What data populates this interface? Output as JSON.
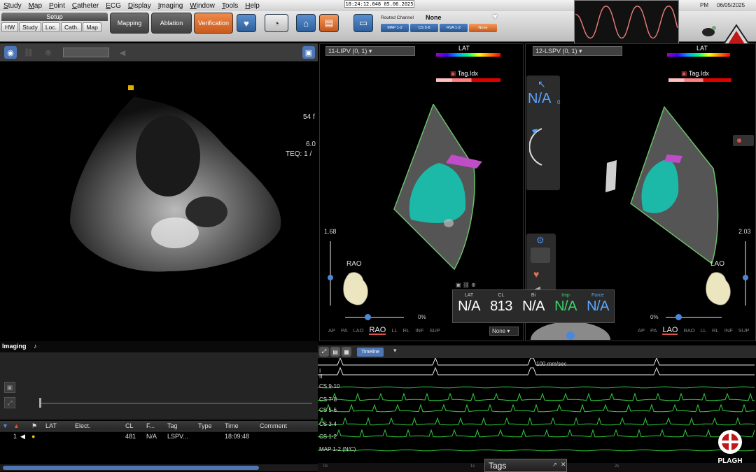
{
  "menu": [
    "Study",
    "Map",
    "Point",
    "Catheter",
    "ECG",
    "Display",
    "Imaging",
    "Window",
    "Tools",
    "Help"
  ],
  "clock": "18:24:12.048  05.06.2025",
  "top_right": {
    "pm": "PM",
    "date": "06/05/2025"
  },
  "toolbar": {
    "setup_title": "Setup",
    "setup_buttons": [
      "HW",
      "Study",
      "Loc.",
      "Cath.",
      "Map"
    ],
    "mapping": "Mapping",
    "ablation": "Ablation",
    "verification": "Verification",
    "routed_label": "Routed Channel",
    "routed_value": "None",
    "routed_buttons": [
      "MAP 1-2",
      "CS 5-6",
      "RVA 1-2",
      "None"
    ]
  },
  "echo": {
    "text1": "54 f",
    "text2": "6.0",
    "text3": "TEQ: 1 /",
    "imaging_label": "Imaging"
  },
  "map_left": {
    "dropdown": "11-LIPV (0, 1)",
    "lat": "LAT",
    "tag": "Tag.Idx",
    "scale": "1.68",
    "orientation": "RAO",
    "pct": "0%",
    "views": [
      "AP",
      "PA",
      "LAO",
      "RAO",
      "LL",
      "RL",
      "INF",
      "SUP"
    ],
    "active_view": "RAO",
    "none_dd": "None"
  },
  "map_right": {
    "dropdown": "12-LSPV (0, 1)",
    "lat": "LAT",
    "tag": "Tag.Idx",
    "scale": "2.03",
    "orientation": "LAO",
    "pct": "0%",
    "views": [
      "AP",
      "PA",
      "LAO",
      "RAO",
      "LL",
      "RL",
      "INF",
      "SUP"
    ],
    "active_view": "LAO"
  },
  "na_panel": {
    "value": "N/A",
    "sub": "0"
  },
  "values": [
    {
      "label": "LAT",
      "value": "N/A",
      "color": "#ffffff"
    },
    {
      "label": "CL",
      "value": "813",
      "color": "#ffffff"
    },
    {
      "label": "Bi",
      "value": "N/A",
      "color": "#ffffff"
    },
    {
      "label": "Imp",
      "value": "N/A",
      "color": "#37d66a"
    },
    {
      "label": "Force",
      "value": "N/A",
      "color": "#5aa8ff"
    }
  ],
  "points_table": {
    "headers": [
      "",
      "",
      "",
      "LAT",
      "Elect.",
      "CL",
      "F...",
      "Tag",
      "Type",
      "Time",
      "Comment"
    ],
    "rows": [
      {
        "index": "1",
        "lat": "",
        "elect": "",
        "cl": "481",
        "f": "N/A",
        "tag": "LSPV...",
        "type": "",
        "time": "18:09:48",
        "comment": ""
      }
    ]
  },
  "egm": {
    "speed": "100 mm/sec",
    "timeline_btn": "Timeline",
    "channels": [
      "I",
      "II",
      "CS 9-10",
      "CS 7-8",
      "CS 5-6",
      "CS 3-4",
      "CS 1-2",
      "MAP 1-2 (N/C)"
    ],
    "time_ticks": [
      "0s",
      "1s",
      "2s"
    ]
  },
  "tags_tab": "Tags",
  "brand": "PLAGH"
}
